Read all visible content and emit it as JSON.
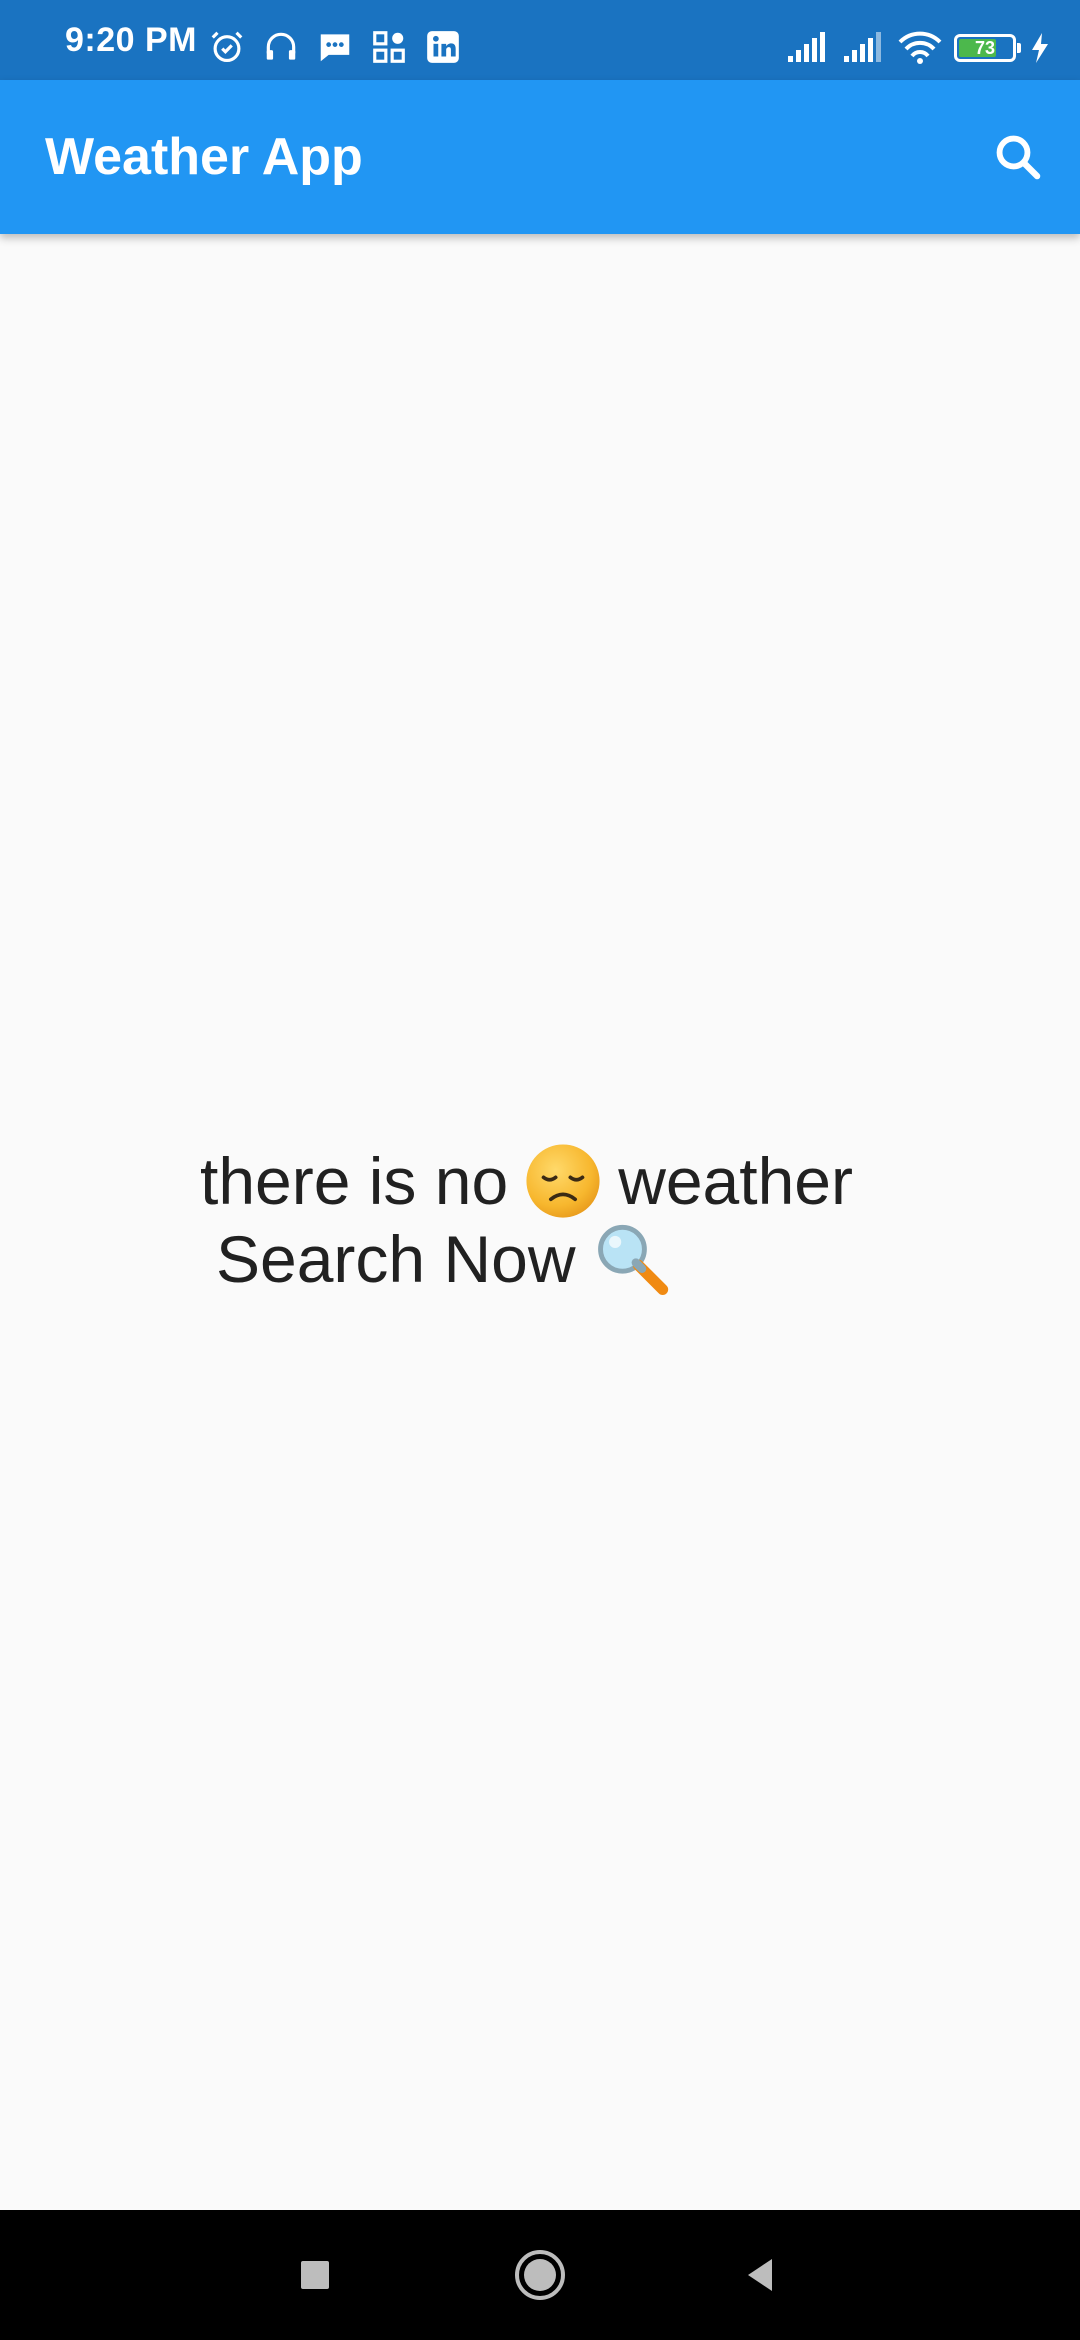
{
  "status_bar": {
    "time": "9:20 PM",
    "battery_level": "73",
    "battery_fraction": 0.73,
    "left_icons": [
      "alarm-icon",
      "headset-icon",
      "message-icon",
      "app-grid-icon",
      "linkedin-icon"
    ],
    "right_icons": [
      "signal-icon",
      "signal-icon",
      "wifi-icon",
      "battery-icon",
      "charging-icon"
    ]
  },
  "app_bar": {
    "title": "Weather App",
    "search_icon": "search-icon"
  },
  "main": {
    "line1_before": "there is no",
    "line1_emoji": "disappointed-face-emoji",
    "line1_after": "weather",
    "line2_text": "Search Now",
    "line2_emoji": "magnifying-glass-emoji"
  },
  "nav_bar": {
    "buttons": [
      "recents-button",
      "home-button",
      "back-button"
    ]
  },
  "colors": {
    "status_bar": "#1a73c1",
    "app_bar": "#2196f3",
    "background": "#fafafa",
    "text": "#212121",
    "battery_fill": "#4cb84c"
  }
}
